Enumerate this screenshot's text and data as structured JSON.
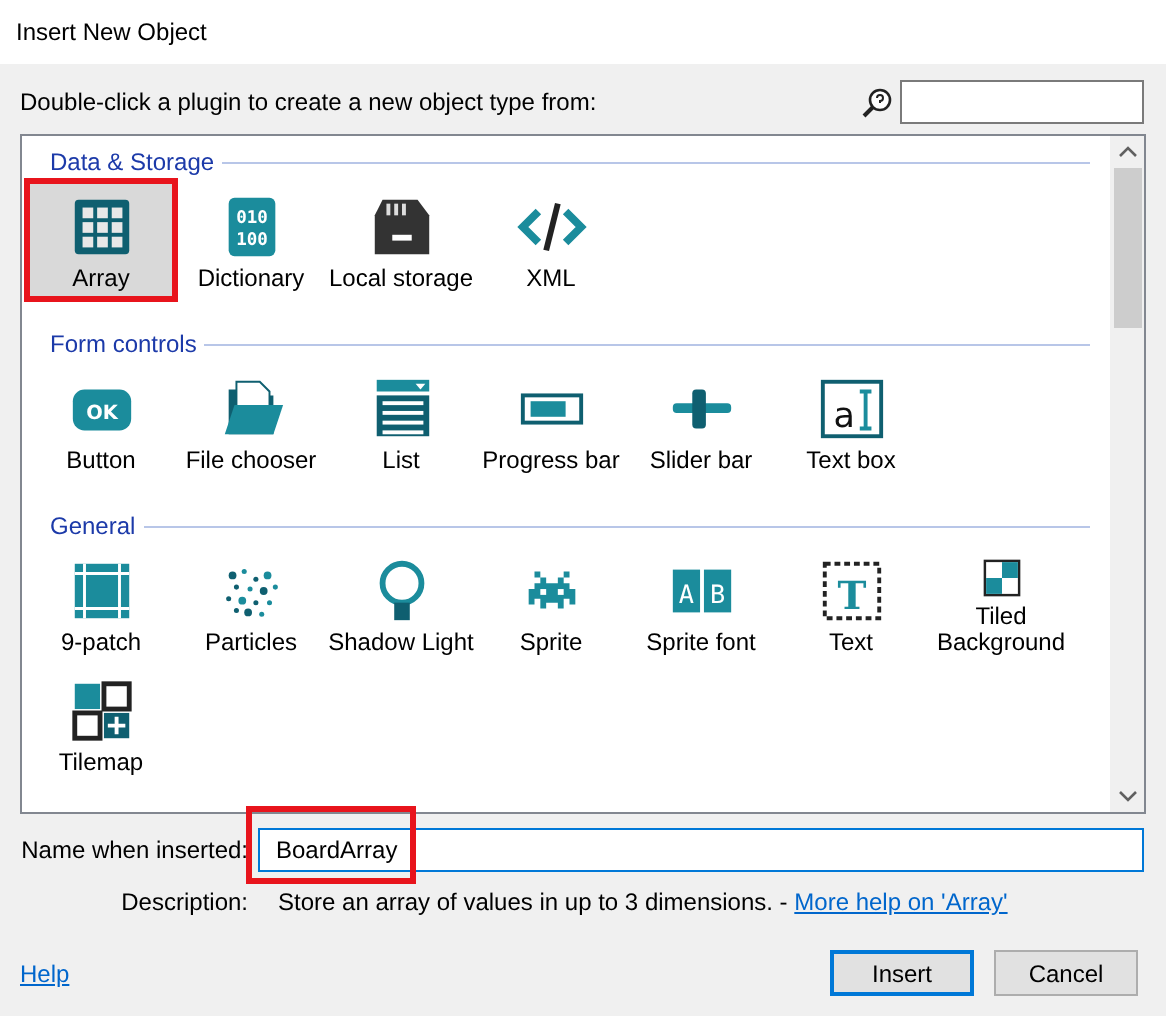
{
  "window": {
    "title": "Insert New Object"
  },
  "instruction": "Double-click a plugin to create a new object type from:",
  "sections": [
    {
      "title": "Data & Storage",
      "items": [
        {
          "label": "Array",
          "selected": true,
          "highlighted": true
        },
        {
          "label": "Dictionary",
          "glyphs": [
            "010",
            "100"
          ],
          "selected": false,
          "highlighted": false
        },
        {
          "label": "Local storage",
          "selected": false,
          "highlighted": false
        },
        {
          "label": "XML",
          "selected": false,
          "highlighted": false
        }
      ]
    },
    {
      "title": "Form controls",
      "items": [
        {
          "label": "Button",
          "glyphs": [
            "OK"
          ],
          "selected": false,
          "highlighted": false
        },
        {
          "label": "File chooser",
          "selected": false,
          "highlighted": false
        },
        {
          "label": "List",
          "selected": false,
          "highlighted": false
        },
        {
          "label": "Progress bar",
          "selected": false,
          "highlighted": false
        },
        {
          "label": "Slider bar",
          "selected": false,
          "highlighted": false
        },
        {
          "label": "Text box",
          "glyphs": [
            "a"
          ],
          "selected": false,
          "highlighted": false
        }
      ]
    },
    {
      "title": "General",
      "items": [
        {
          "label": "9-patch",
          "selected": false,
          "highlighted": false
        },
        {
          "label": "Particles",
          "selected": false,
          "highlighted": false
        },
        {
          "label": "Shadow Light",
          "selected": false,
          "highlighted": false
        },
        {
          "label": "Sprite",
          "selected": false,
          "highlighted": false
        },
        {
          "label": "Sprite font",
          "glyphs": [
            "A",
            "B"
          ],
          "selected": false,
          "highlighted": false
        },
        {
          "label": "Text",
          "glyphs": [
            "T"
          ],
          "selected": false,
          "highlighted": false
        },
        {
          "label": "Tiled Background",
          "selected": false,
          "highlighted": false
        },
        {
          "label": "Tilemap",
          "selected": false,
          "highlighted": false
        }
      ]
    }
  ],
  "name_field": {
    "label": "Name when inserted:",
    "value": "BoardArray",
    "highlighted": true
  },
  "description": {
    "label": "Description:",
    "text": "Store an array of values in up to 3 dimensions. -",
    "link": "More help on 'Array'"
  },
  "help_link": "Help",
  "buttons": [
    {
      "label": "Insert",
      "default": true
    },
    {
      "label": "Cancel",
      "default": false
    }
  ]
}
